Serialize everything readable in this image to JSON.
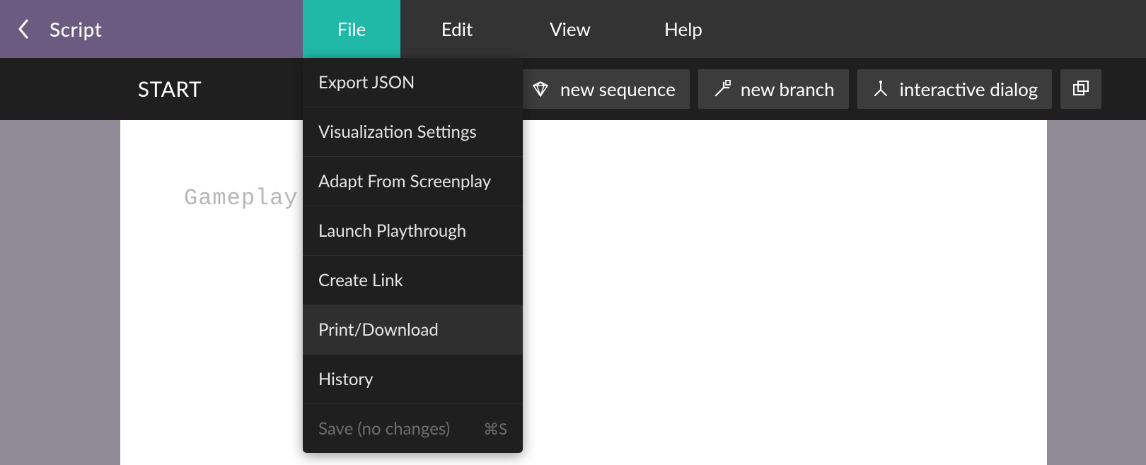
{
  "header": {
    "script_label": "Script",
    "menus": {
      "file": "File",
      "edit": "Edit",
      "view": "View",
      "help": "Help"
    }
  },
  "toolbar": {
    "start_label": "START",
    "buttons": {
      "new_sequence": "new sequence",
      "new_branch": "new branch",
      "interactive_dialog": "interactive dialog"
    }
  },
  "page": {
    "placeholder_text": "Gameplay"
  },
  "file_menu": {
    "items": [
      {
        "label": "Export JSON"
      },
      {
        "label": "Visualization Settings"
      },
      {
        "label": "Adapt From Screenplay"
      },
      {
        "label": "Launch Playthrough"
      },
      {
        "label": "Create Link"
      },
      {
        "label": "Print/Download"
      },
      {
        "label": "History"
      },
      {
        "label": "Save (no changes)",
        "shortcut": "⌘S",
        "disabled": true
      }
    ],
    "hover_index": 5
  }
}
